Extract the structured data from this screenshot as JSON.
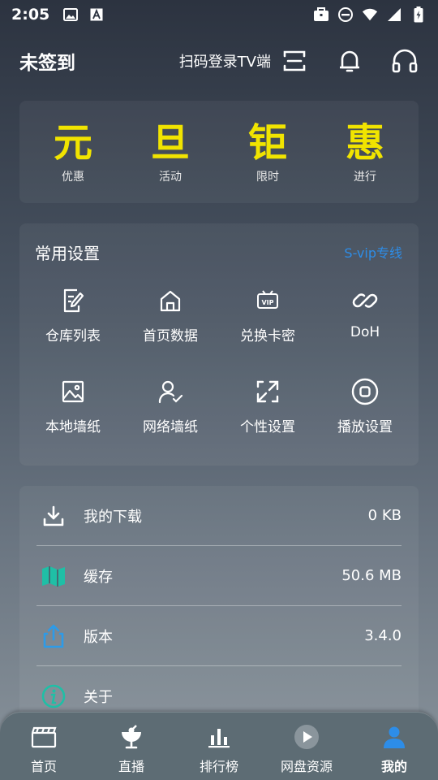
{
  "status_bar": {
    "time": "2:05"
  },
  "header": {
    "title": "未签到",
    "scan_login": "扫码登录TV端"
  },
  "promo": {
    "items": [
      {
        "char": "元",
        "label": "优惠"
      },
      {
        "char": "旦",
        "label": "活动"
      },
      {
        "char": "钜",
        "label": "限时"
      },
      {
        "char": "惠",
        "label": "进行"
      }
    ],
    "color": "#f1e400"
  },
  "settings": {
    "title": "常用设置",
    "svip_link": "S-vip专线",
    "items": [
      {
        "label": "仓库列表",
        "icon": "edit-doc-icon"
      },
      {
        "label": "首页数据",
        "icon": "home-icon"
      },
      {
        "label": "兑换卡密",
        "icon": "vip-ticket-icon"
      },
      {
        "label": "DoH",
        "icon": "link-icon"
      },
      {
        "label": "本地墙纸",
        "icon": "image-icon"
      },
      {
        "label": "网络墙纸",
        "icon": "user-check-icon"
      },
      {
        "label": "个性设置",
        "icon": "expand-icon"
      },
      {
        "label": "播放设置",
        "icon": "stop-circle-icon"
      }
    ]
  },
  "info": {
    "rows": [
      {
        "label": "我的下载",
        "value": "0 KB",
        "icon": "download-icon"
      },
      {
        "label": "缓存",
        "value": "50.6 MB",
        "icon": "map-icon"
      },
      {
        "label": "版本",
        "value": "3.4.0",
        "icon": "share-icon"
      },
      {
        "label": "关于",
        "value": "",
        "icon": "info-icon"
      }
    ]
  },
  "bottom_nav": {
    "items": [
      {
        "label": "首页",
        "icon": "clapperboard-icon"
      },
      {
        "label": "直播",
        "icon": "satellite-icon"
      },
      {
        "label": "排行榜",
        "icon": "bar-chart-icon"
      },
      {
        "label": "网盘资源",
        "icon": "play-disc-icon"
      },
      {
        "label": "我的",
        "icon": "person-icon"
      }
    ],
    "active_index": 4,
    "active_color": "#2d8de8"
  },
  "colors": {
    "accent_blue": "#2d8de8",
    "teal": "#1fbfa6",
    "promo_yellow": "#f1e400"
  }
}
